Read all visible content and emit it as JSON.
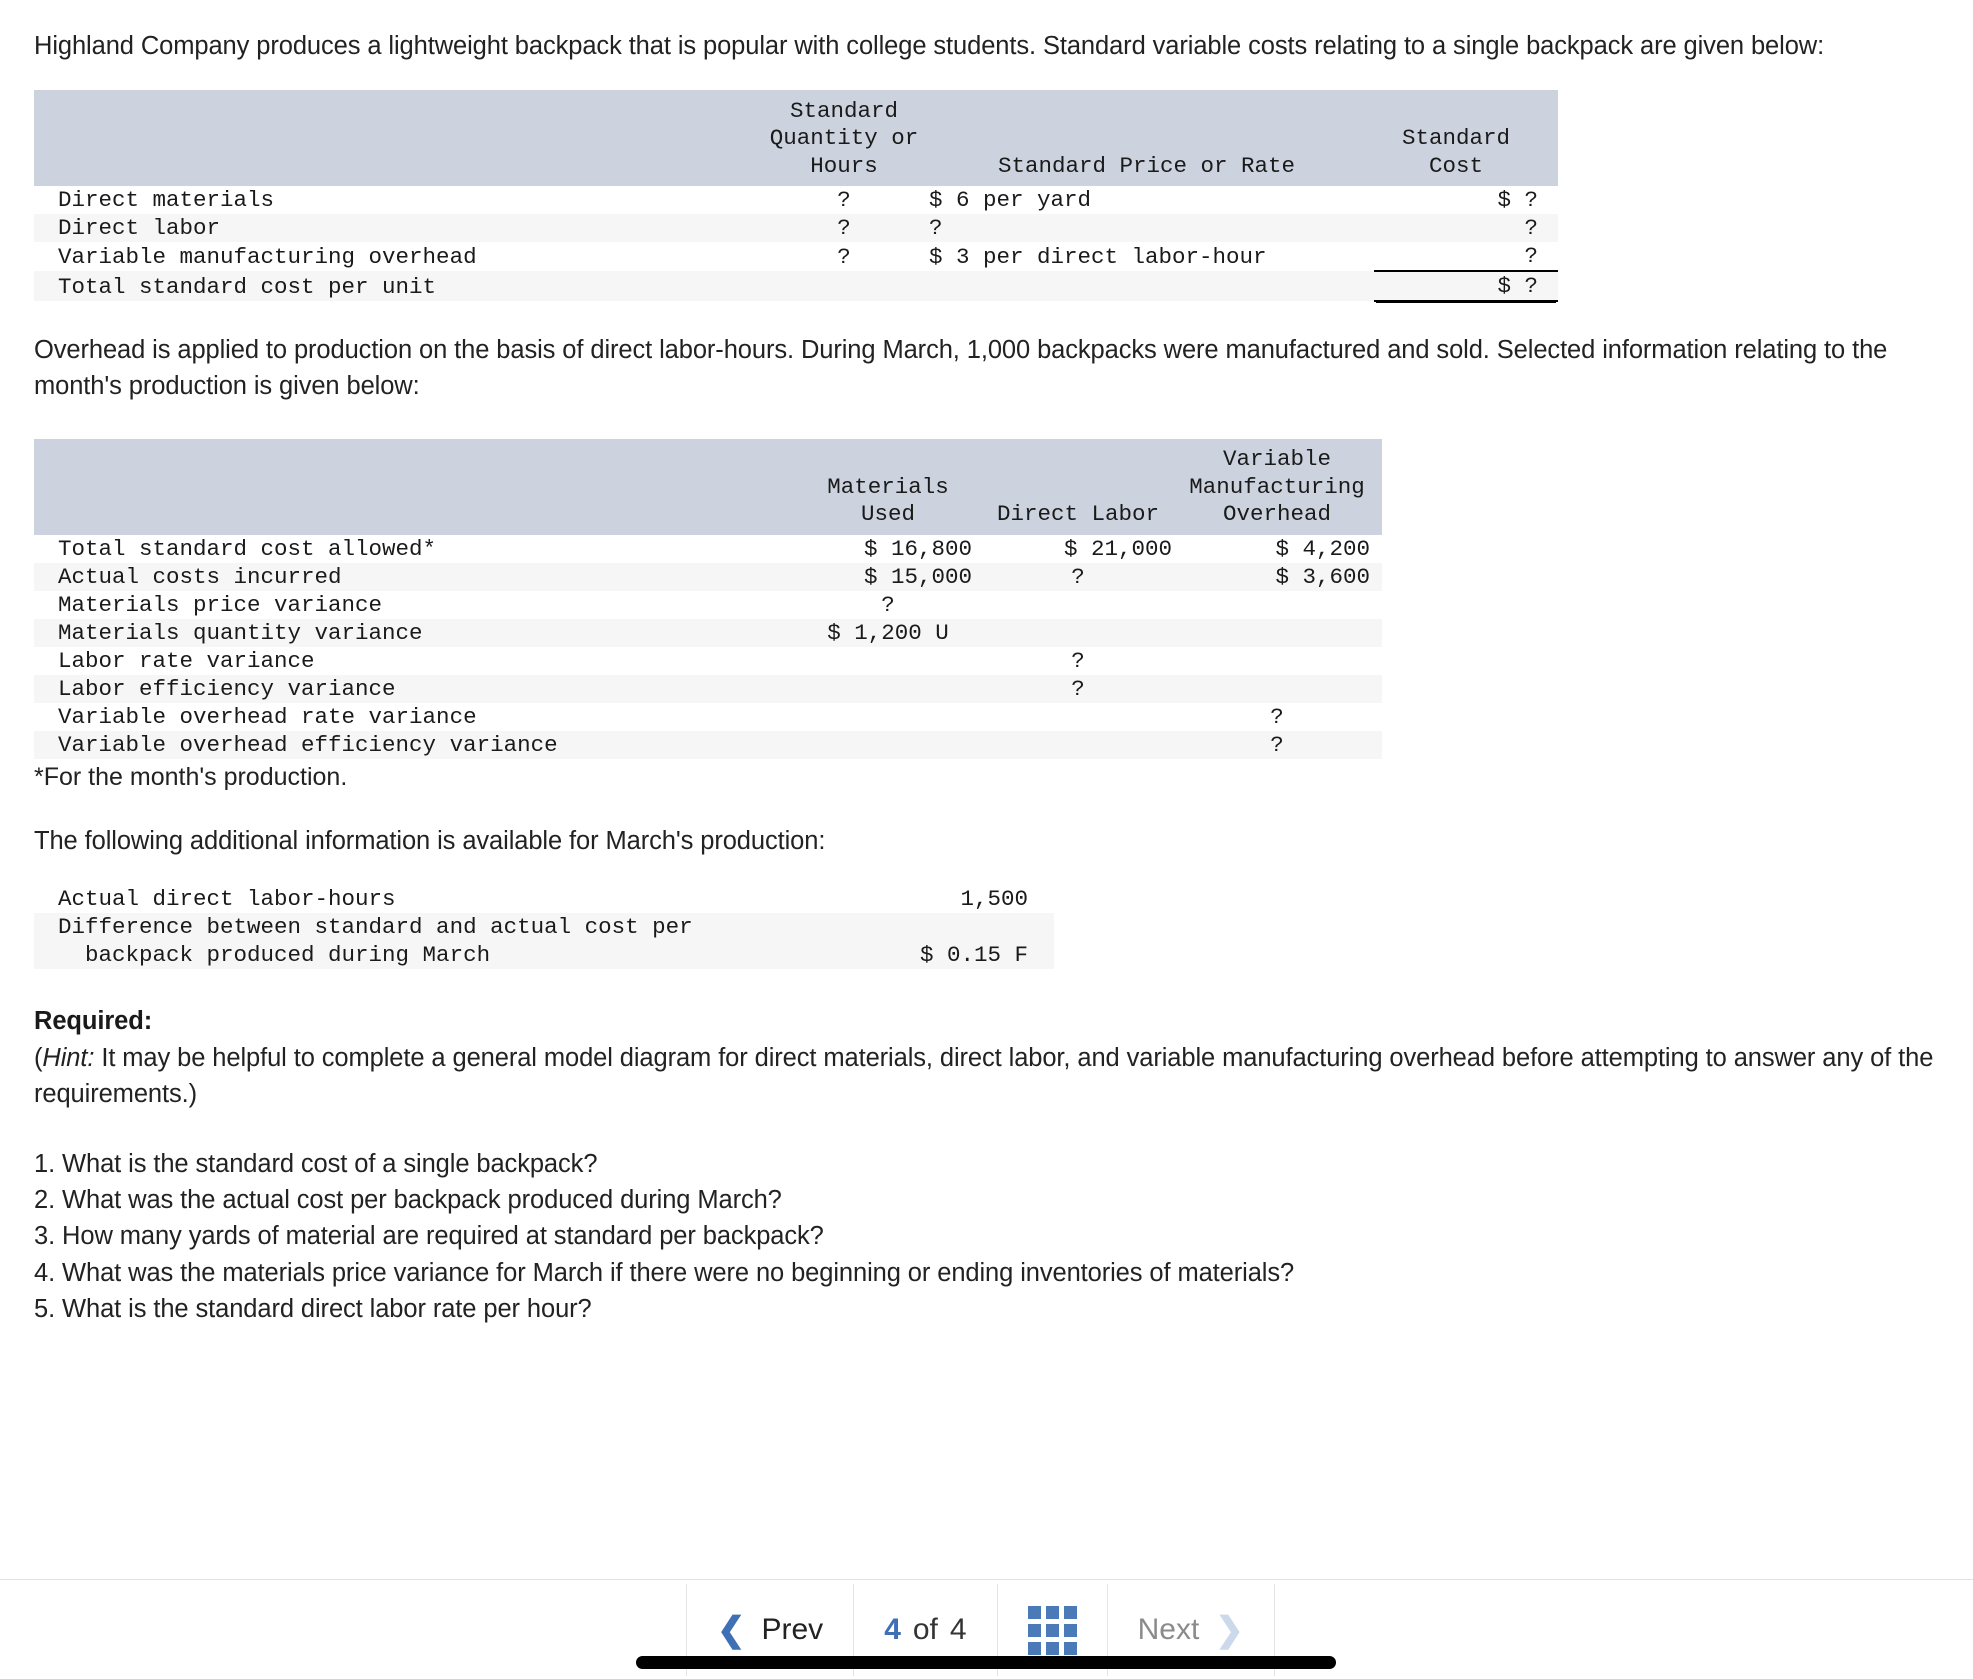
{
  "intro": {
    "paragraph1": "Highland Company produces a lightweight backpack that is popular with college students. Standard variable costs relating to a single backpack are given below:",
    "paragraph2": "Overhead is applied to production on the basis of direct labor-hours. During March, 1,000 backpacks were manufactured and sold. Selected information relating to the month's production is given below:",
    "paragraph3": "The following additional information is available for March's production:"
  },
  "standard_cost_table": {
    "headers": {
      "blank": "",
      "quantity": "Standard\nQuantity or\nHours",
      "price": "Standard Price or Rate",
      "cost": "Standard\nCost"
    },
    "rows": [
      {
        "label": "Direct materials",
        "quantity": "?",
        "price": "$ 6 per yard",
        "cost": "$ ?"
      },
      {
        "label": "Direct labor",
        "quantity": "?",
        "price": "?",
        "cost": "?"
      },
      {
        "label": "Variable manufacturing overhead",
        "quantity": "?",
        "price": "$ 3 per direct labor-hour",
        "cost": "?"
      },
      {
        "label": "Total standard cost per unit",
        "quantity": "",
        "price": "",
        "cost": "$ ?"
      }
    ]
  },
  "variance_table": {
    "headers": {
      "blank": "",
      "materials": "Materials\nUsed",
      "labor": "Direct Labor",
      "overhead": "Variable\nManufacturing\nOverhead"
    },
    "rows": [
      {
        "label": "Total standard cost allowed*",
        "materials": "$ 16,800",
        "labor": "$ 21,000",
        "overhead": "$ 4,200"
      },
      {
        "label": "Actual costs incurred",
        "materials": "$ 15,000",
        "labor": "?",
        "overhead": "$ 3,600"
      },
      {
        "label": "Materials price variance",
        "materials": "?",
        "labor": "",
        "overhead": ""
      },
      {
        "label": "Materials quantity variance",
        "materials": "$ 1,200 U",
        "labor": "",
        "overhead": ""
      },
      {
        "label": "Labor rate variance",
        "materials": "",
        "labor": "?",
        "overhead": ""
      },
      {
        "label": "Labor efficiency variance",
        "materials": "",
        "labor": "?",
        "overhead": ""
      },
      {
        "label": "Variable overhead rate variance",
        "materials": "",
        "labor": "",
        "overhead": "?"
      },
      {
        "label": "Variable overhead efficiency variance",
        "materials": "",
        "labor": "",
        "overhead": "?"
      }
    ],
    "footnote": "*For the month's production."
  },
  "additional_table": {
    "rows": [
      {
        "label": "Actual direct labor-hours",
        "value": "1,500"
      },
      {
        "label_line1": "Difference between standard and actual cost per",
        "label_line2": "  backpack produced during March",
        "value": "$ 0.15 F"
      }
    ]
  },
  "required": {
    "heading": "Required:",
    "hint_prefix": "(",
    "hint_italic": "Hint:",
    "hint_text": " It may be helpful to complete a general model diagram for direct materials, direct labor, and variable manufacturing overhead before attempting to answer any of the requirements.)",
    "questions": [
      "1. What is the standard cost of a single backpack?",
      "2. What was the actual cost per backpack produced during March?",
      "3. How many yards of material are required at standard per backpack?",
      "4. What was the materials price variance for March if there were no beginning or ending inventories of materials?",
      "5. What is the standard direct labor rate per hour?"
    ]
  },
  "nav": {
    "prev_label": "Prev",
    "prev_icon": "chevron-left-icon",
    "next_label": "Next",
    "next_icon": "chevron-right-icon",
    "page_current": "4",
    "page_of": "of",
    "page_total": "4",
    "grid_icon": "grid-menu-icon"
  },
  "colors": {
    "table_header_bg": "#ccd3de",
    "row_alt_bg": "#f6f6f6",
    "accent_blue": "#3f6fb5",
    "grid_blue": "#4a7ab8",
    "disabled_gray": "#8b8b8b"
  }
}
